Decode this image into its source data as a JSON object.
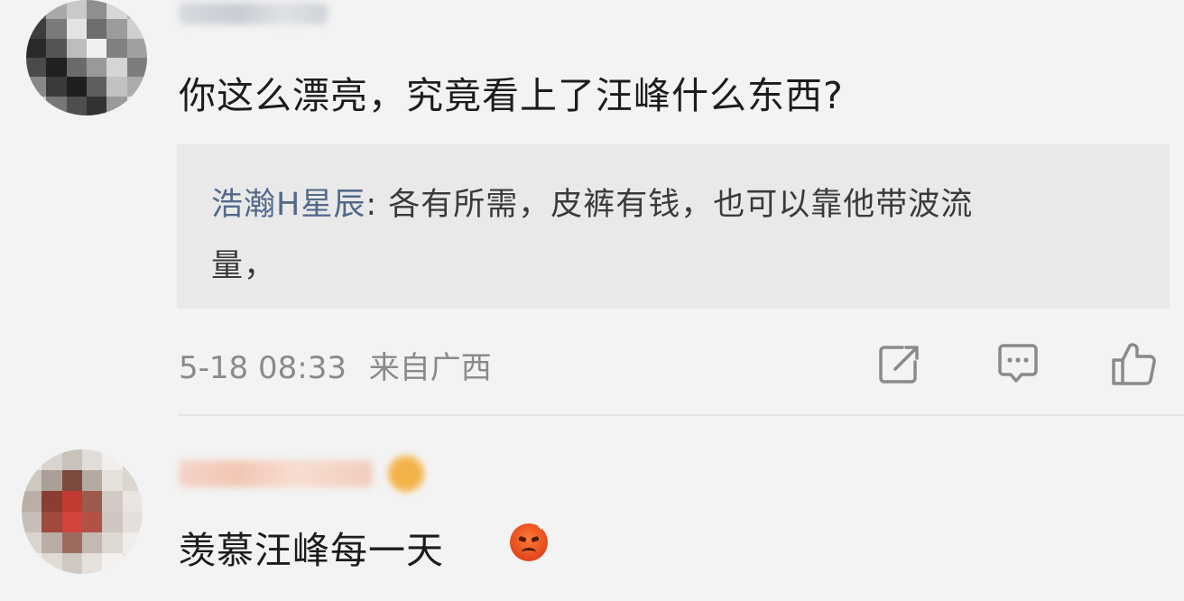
{
  "comments": [
    {
      "text": "你这么漂亮，究竟看上了汪峰什么东西?",
      "reply": {
        "author": "浩瀚H星辰",
        "separator": ": ",
        "text_line1": "各有所需，皮裤有钱，也可以靠他带波流",
        "text_line2": "量，"
      },
      "meta": {
        "time": "5-18 08:33",
        "location": "来自广西"
      },
      "actions": [
        "share-icon",
        "comment-icon",
        "like-icon"
      ]
    },
    {
      "text": "羡慕汪峰每一天",
      "emoji": "angry-face-icon"
    }
  ],
  "colors": {
    "background": "#f3f3f3",
    "reply_background": "#e9e9e9",
    "author_link": "#52698a",
    "meta_text": "#8a8a8a",
    "body_text": "#1c1c1c"
  }
}
